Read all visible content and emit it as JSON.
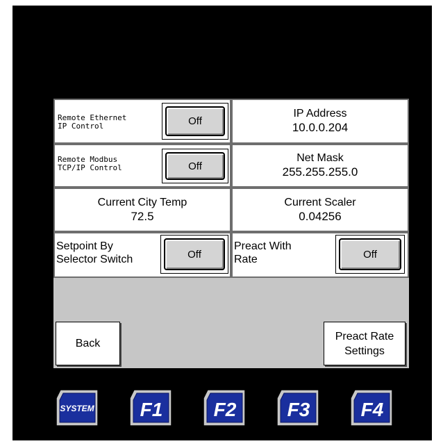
{
  "rows": {
    "remote_ethernet": {
      "label": "Remote Ethernet\nIP Control",
      "button": "Off"
    },
    "ip_address": {
      "label": "IP Address",
      "value": "10.0.0.204"
    },
    "remote_modbus": {
      "label": "Remote Modbus\nTCP/IP Control",
      "button": "Off"
    },
    "net_mask": {
      "label": "Net Mask",
      "value": "255.255.255.0"
    },
    "current_city_temp": {
      "label": "Current City Temp",
      "value": "72.5"
    },
    "current_scaler": {
      "label": "Current Scaler",
      "value": "0.04256"
    },
    "setpoint_selector": {
      "label_line1": "Setpoint By",
      "label_line2": "Selector Switch",
      "button": "Off"
    },
    "preact_with_rate": {
      "label_line1": "Preact With",
      "label_line2": "Rate",
      "button": "Off"
    }
  },
  "nav": {
    "back": "Back",
    "preact_rate_line1": "Preact Rate",
    "preact_rate_line2": "Settings"
  },
  "function_keys": [
    {
      "label": "SYSTEM",
      "icon": "system-key-icon"
    },
    {
      "label": "F1",
      "icon": "f1-key-icon"
    },
    {
      "label": "F2",
      "icon": "f2-key-icon"
    },
    {
      "label": "F3",
      "icon": "f3-key-icon"
    },
    {
      "label": "F4",
      "icon": "f4-key-icon"
    }
  ],
  "colors": {
    "screen": "#000000",
    "panel": "#c6c6c6",
    "key_blue": "#1a2f9e",
    "key_frame": "#c8c8c8"
  }
}
